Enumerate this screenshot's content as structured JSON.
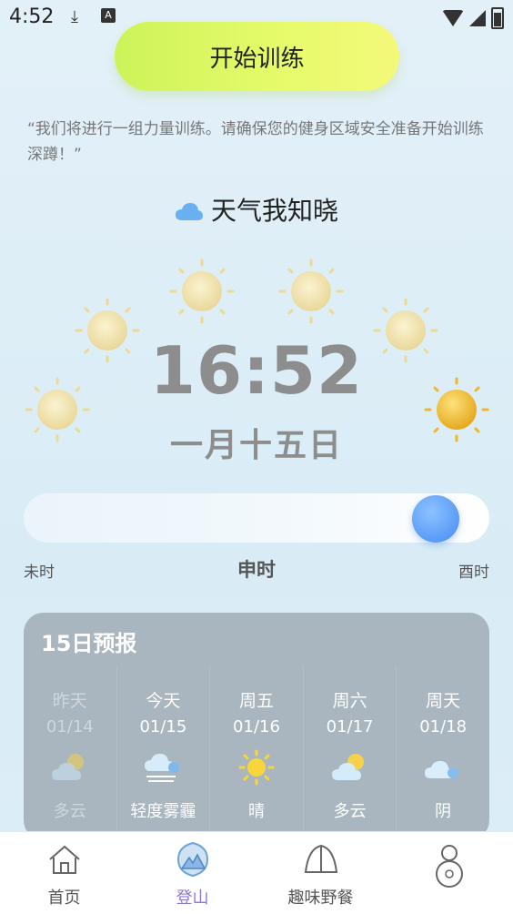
{
  "status_bar": {
    "time": "4:52"
  },
  "start_button": {
    "label": "开始训练"
  },
  "intro_text": "“我们将进行一组力量训练。请确保您的健身区域安全准备开始训练深蹲！”",
  "weather_title": "天气我知晓",
  "clock": {
    "time": "16:52",
    "date": "一月十五日"
  },
  "time_slider": {
    "left_label": "未时",
    "center_label": "申时",
    "right_label": "酉时",
    "level": 0.92
  },
  "forecast": {
    "title": "15日预报",
    "days": [
      {
        "name": "昨天",
        "date": "01/14",
        "desc": "多云",
        "icon": "partly-cloudy-icon",
        "past": true
      },
      {
        "name": "今天",
        "date": "01/15",
        "desc": "轻度雾霾",
        "icon": "haze-icon",
        "past": false
      },
      {
        "name": "周五",
        "date": "01/16",
        "desc": "晴",
        "icon": "sunny-icon",
        "past": false
      },
      {
        "name": "周六",
        "date": "01/17",
        "desc": "多云",
        "icon": "partly-cloudy-icon",
        "past": false
      },
      {
        "name": "周天",
        "date": "01/18",
        "desc": "阴",
        "icon": "cloudy-icon",
        "past": false
      }
    ]
  },
  "nav": {
    "items": [
      {
        "label": "首页",
        "icon": "home-icon"
      },
      {
        "label": "登山",
        "icon": "mountain-icon",
        "active": true
      },
      {
        "label": "趣味野餐",
        "icon": "tent-icon"
      },
      {
        "label": "",
        "icon": "profile-icon"
      }
    ]
  },
  "colors": {
    "accent": "#5a9bf7",
    "start_button": "#d8f55f",
    "nav_active": "#8a7ad6"
  }
}
